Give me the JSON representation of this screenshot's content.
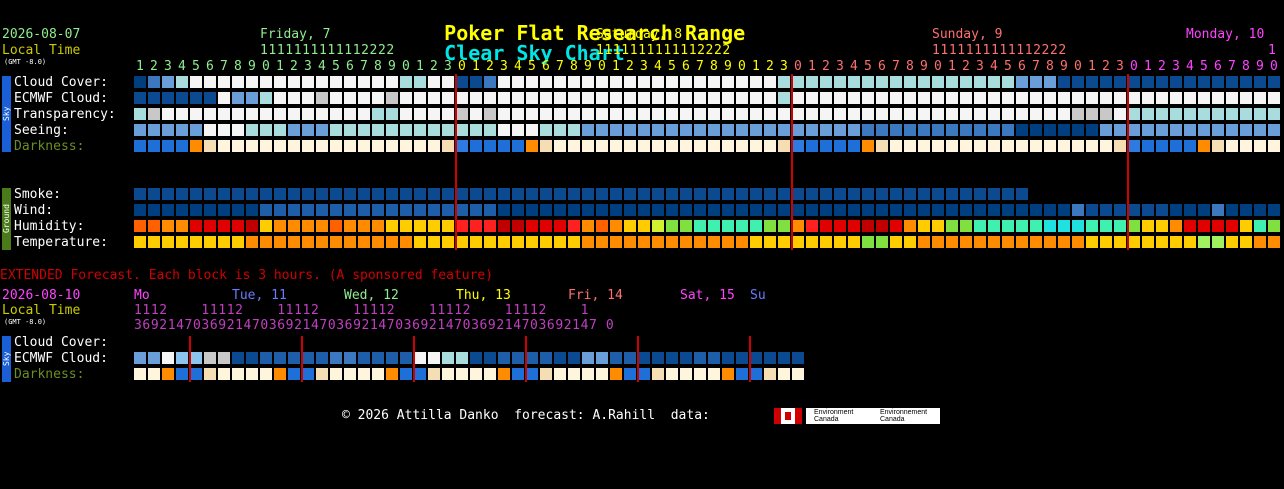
{
  "title": {
    "part1": "Poker Flat Research Range",
    "part2": "Clear Sky Chart",
    "color1": "#ffff00",
    "color2": "#00e5e5"
  },
  "header": {
    "date": "2026-08-07",
    "local_time": "Local Time",
    "gmt": "(GMT -8.0)",
    "days": [
      {
        "label": "Friday, 7",
        "color": "#90ee90"
      },
      {
        "label": "Saturday, 8",
        "color": "#ffff00"
      },
      {
        "label": "Sunday, 9",
        "color": "#ff7070"
      },
      {
        "label": "Monday, 10",
        "color": "#ff44ff"
      }
    ],
    "hour_tens": "1111111111112222",
    "hour_tens_day4": "1",
    "hour_ones_day1": "1234567890123456789012301234567890123",
    "hour_ones_rest": "01234567890123456789012301234567890"
  },
  "rows": {
    "cloud": "Cloud Cover:",
    "ecmwf": "ECMWF Cloud:",
    "transparency": "Transparency:",
    "seeing": "Seeing:",
    "darkness": "Darkness:",
    "smoke": "Smoke:",
    "wind": "Wind:",
    "humidity": "Humidity:",
    "temperature": "Temperature:"
  },
  "side_labels": {
    "sky": "Sky",
    "ground": "Ground"
  },
  "extended": {
    "notice": "EXTENDED Forecast. Each block is 3 hours. (A sponsored feature)",
    "date": "2026-08-10",
    "local_time": "Local Time",
    "gmt": "(GMT -8.0)",
    "days": [
      {
        "label": "Mo",
        "color": "#ff44ff"
      },
      {
        "label": "Tue, 11",
        "color": "#6a7bff"
      },
      {
        "label": "Wed, 12",
        "color": "#90ee90"
      },
      {
        "label": "Thu, 13",
        "color": "#ffff00"
      },
      {
        "label": "Fri, 14",
        "color": "#ff7070"
      },
      {
        "label": "Sat, 15",
        "color": "#ff44ff"
      },
      {
        "label": "Su",
        "color": "#6a7bff"
      }
    ],
    "tens": "1112    11112    11112    11112    11112    11112    1",
    "ones": "3692147036921470369214703692147036921470369214703692147 0",
    "cloud": "Cloud Cover:",
    "ecmwf": "ECMWF Cloud:",
    "darkness": "Darkness:"
  },
  "footer": {
    "copyright": "© 2026 Attilla Danko  forecast: A.Rahill  data:",
    "logo1": "Environment Canada",
    "logo2": "Environnement Canada"
  },
  "colors": {
    "dark_label": "#6b8e23",
    "accent_red": "#d00000"
  }
}
